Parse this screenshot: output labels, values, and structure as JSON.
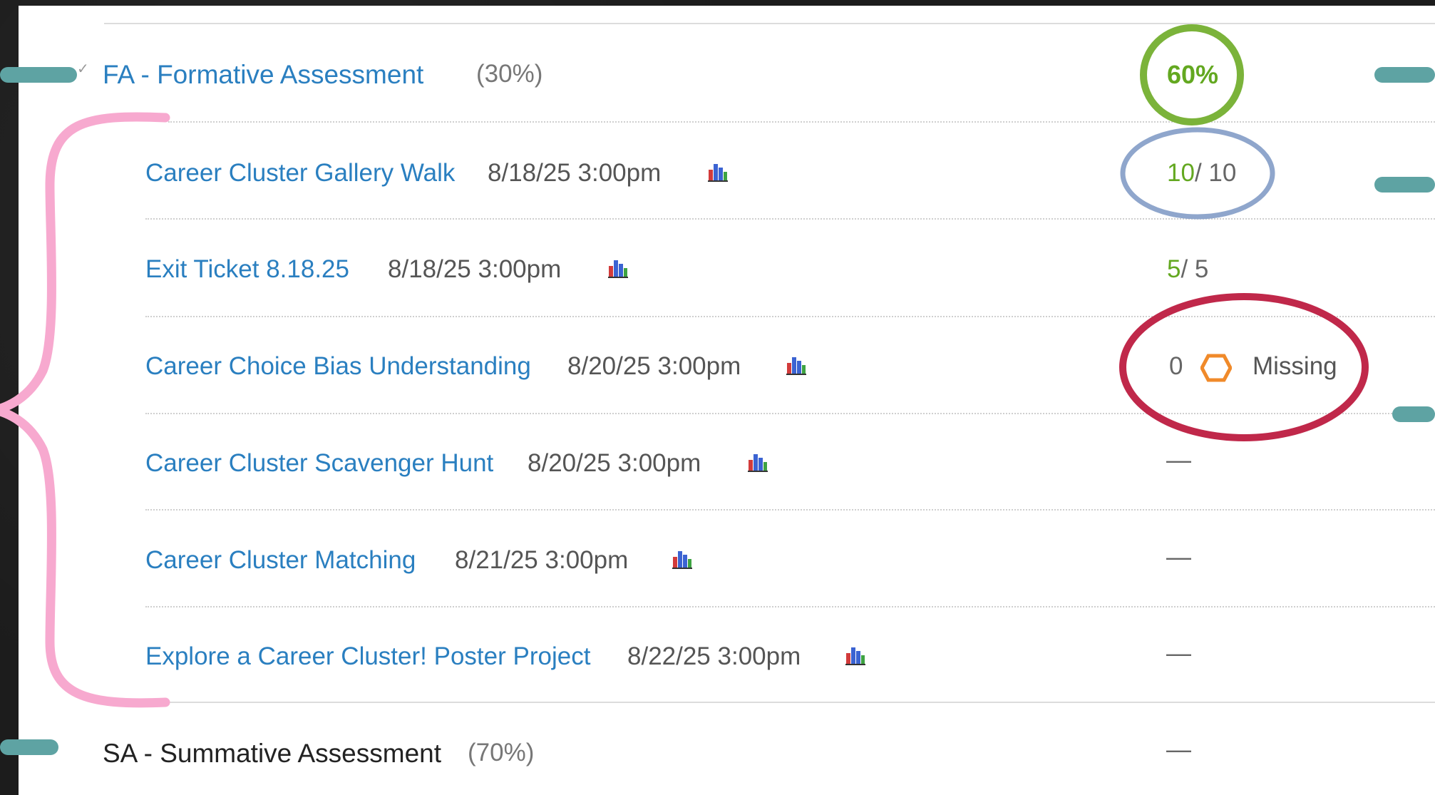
{
  "categories": [
    {
      "title": "FA - Formative Assessment",
      "weight": "(30%)",
      "grade": "60%",
      "items": [
        {
          "title": "Career Cluster Gallery Walk",
          "due": "8/18/25 3:00pm",
          "score_got": "10",
          "score_max": "/ 10"
        },
        {
          "title": "Exit Ticket 8.18.25",
          "due": "8/18/25 3:00pm",
          "score_got": "5",
          "score_max": "/ 5"
        },
        {
          "title": "Career Choice Bias Understanding",
          "due": "8/20/25 3:00pm",
          "score_value": "0",
          "status": "Missing"
        },
        {
          "title": "Career Cluster Scavenger Hunt",
          "due": "8/20/25 3:00pm",
          "score_value": "—"
        },
        {
          "title": "Career Cluster Matching",
          "due": "8/21/25 3:00pm",
          "score_value": "—"
        },
        {
          "title": "Explore a Career Cluster! Poster Project",
          "due": "8/22/25 3:00pm",
          "score_value": "—"
        }
      ]
    },
    {
      "title": "SA - Summative Assessment",
      "weight": "(70%)",
      "grade": "—"
    }
  ],
  "colors": {
    "link": "#2a7fc0",
    "score_green": "#63a820",
    "annotation_green": "#7bb33a",
    "annotation_blue": "#8fa6cc",
    "annotation_red": "#c0284a",
    "annotation_pink": "#f7a9cf",
    "annotation_teal": "#5ea3a3",
    "missing_icon": "#f08a2a"
  },
  "icons": {
    "stats": "bar-chart-icon",
    "missing": "hexagon-missing-icon"
  }
}
